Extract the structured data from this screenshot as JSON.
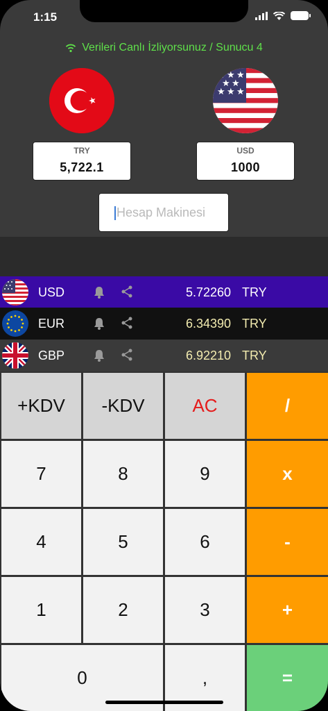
{
  "status_bar": {
    "time": "1:15"
  },
  "header": {
    "live_text": "Verileri Canlı İzliyorsunuz / Sunucu 4",
    "from_currency": {
      "code": "TRY",
      "value": "5,722.1"
    },
    "to_currency": {
      "code": "USD",
      "value": "1000"
    },
    "calculator_input": {
      "placeholder": "Hesap Makinesi",
      "value": ""
    }
  },
  "rates": [
    {
      "code": "USD",
      "rate": "5.72260",
      "unit": "TRY",
      "flag": "us-flag"
    },
    {
      "code": "EUR",
      "rate": "6.34390",
      "unit": "TRY",
      "flag": "eu-flag"
    },
    {
      "code": "GBP",
      "rate": "6.92210",
      "unit": "TRY",
      "flag": "uk-flag"
    }
  ],
  "keypad": {
    "plus_kdv": "+KDV",
    "minus_kdv": "-KDV",
    "clear": "AC",
    "divide": "/",
    "seven": "7",
    "eight": "8",
    "nine": "9",
    "multiply": "x",
    "four": "4",
    "five": "5",
    "six": "6",
    "minus": "-",
    "one": "1",
    "two": "2",
    "three": "3",
    "plus": "+",
    "zero": "0",
    "comma": ",",
    "equals": "="
  },
  "colors": {
    "live_green": "#5fe04a",
    "usd_row": "#3a0aa5",
    "operator_orange": "#ff9c00",
    "equals_green": "#6bd07a",
    "clear_red": "#e51b1b"
  }
}
